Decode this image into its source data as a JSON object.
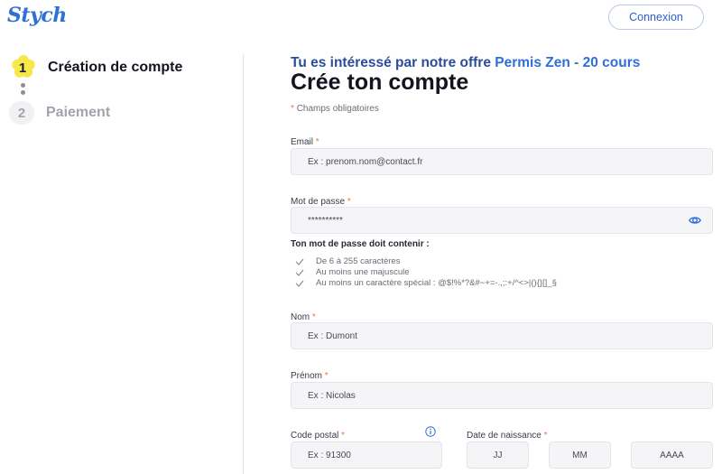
{
  "header": {
    "logo": "Stych",
    "login_button": "Connexion"
  },
  "steps": [
    {
      "number": "1",
      "label": "Création de compte",
      "active": true
    },
    {
      "number": "2",
      "label": "Paiement",
      "active": false
    }
  ],
  "form": {
    "offer_prefix": "Tu es intéressé par notre offre",
    "offer_name": "Permis Zen - 20 cours",
    "title": "Crée ton compte",
    "required_star": "*",
    "required_note": "Champs obligatoires",
    "email": {
      "label": "Email",
      "placeholder": "Ex : prenom.nom@contact.fr"
    },
    "password": {
      "label": "Mot de passe",
      "value": "**********"
    },
    "password_rules_title": "Ton mot de passe doit contenir :",
    "password_rules": [
      "De 6 à 255 caractères",
      "Au moins une majuscule",
      "Au moins un caractère spécial : @$!%*?&#~+=-.,;:+/^<>|(){}[]_§"
    ],
    "lastname": {
      "label": "Nom",
      "placeholder": "Ex : Dumont"
    },
    "firstname": {
      "label": "Prénom",
      "placeholder": "Ex : Nicolas"
    },
    "postal_code": {
      "label": "Code postal",
      "placeholder": "Ex : 91300"
    },
    "birth_date": {
      "label": "Date de naissance",
      "day": "JJ",
      "month": "MM",
      "year": "AAAA"
    }
  },
  "colors": {
    "brand_blue": "#2f6fd6",
    "required_orange": "#f5733a",
    "active_step_yellow": "#f6e84a"
  },
  "icons": [
    "flower-badge-icon",
    "eye-icon",
    "check-icon",
    "info-icon"
  ]
}
